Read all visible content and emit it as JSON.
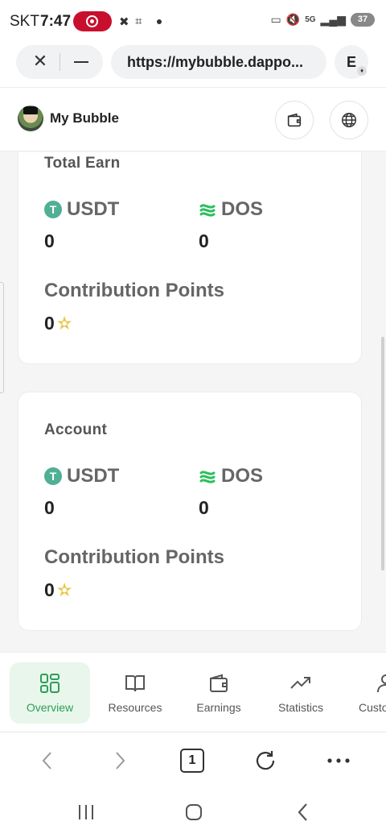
{
  "status_bar": {
    "carrier": "SKT",
    "time": "7:47",
    "battery_level": "37",
    "network": "5G"
  },
  "browser": {
    "url": "https://mybubble.dappo...",
    "extension_label": "E",
    "tab_count": "1"
  },
  "app": {
    "name": "My Bubble"
  },
  "total_earn": {
    "title": "Total Earn",
    "usdt_label": "USDT",
    "usdt_value": "0",
    "dos_label": "DOS",
    "dos_value": "0",
    "cp_label": "Contribution Points",
    "cp_value": "0"
  },
  "account": {
    "title": "Account",
    "usdt_label": "USDT",
    "usdt_value": "0",
    "dos_label": "DOS",
    "dos_value": "0",
    "cp_label": "Contribution Points",
    "cp_value": "0"
  },
  "nav": {
    "items": [
      {
        "label": "Overview",
        "icon": "grid-icon",
        "active": true
      },
      {
        "label": "Resources",
        "icon": "book-icon",
        "active": false
      },
      {
        "label": "Earnings",
        "icon": "wallet-icon",
        "active": false
      },
      {
        "label": "Statistics",
        "icon": "trending-up-icon",
        "active": false
      },
      {
        "label": "Custo",
        "icon": "user-icon",
        "active": false
      }
    ]
  },
  "colors": {
    "accent_green": "#2e9e57",
    "tether_green": "#50af95",
    "record_red": "#c8102e"
  }
}
